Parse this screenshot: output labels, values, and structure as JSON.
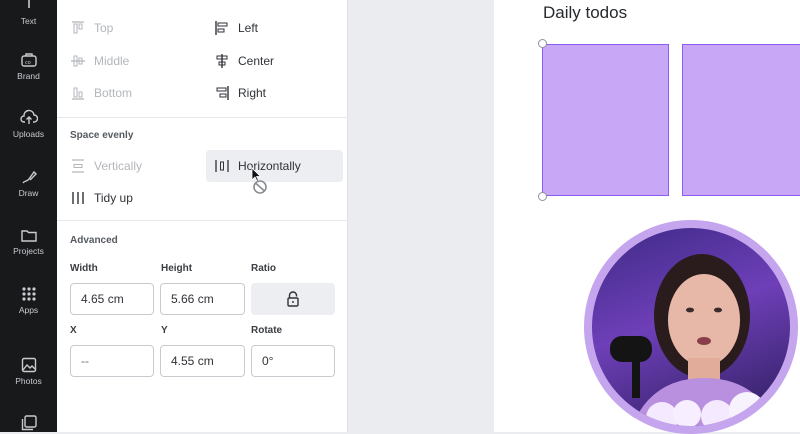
{
  "rail": {
    "items": [
      {
        "label": "Text",
        "icon": "text-icon"
      },
      {
        "label": "Brand",
        "icon": "brand-icon"
      },
      {
        "label": "Uploads",
        "icon": "uploads-icon"
      },
      {
        "label": "Draw",
        "icon": "draw-icon"
      },
      {
        "label": "Projects",
        "icon": "projects-icon"
      },
      {
        "label": "Apps",
        "icon": "apps-icon"
      },
      {
        "label": "Photos",
        "icon": "photos-icon"
      }
    ]
  },
  "align": {
    "top": "Top",
    "middle": "Middle",
    "bottom": "Bottom",
    "left": "Left",
    "center": "Center",
    "right": "Right"
  },
  "space": {
    "title": "Space evenly",
    "vertically": "Vertically",
    "horizontally": "Horizontally",
    "tidy": "Tidy up"
  },
  "advanced": {
    "title": "Advanced",
    "width_label": "Width",
    "height_label": "Height",
    "ratio_label": "Ratio",
    "x_label": "X",
    "y_label": "Y",
    "rotate_label": "Rotate",
    "width": "4.65 cm",
    "height": "5.66 cm",
    "x": "--",
    "y": "4.55 cm",
    "rotate": "0°"
  },
  "canvas": {
    "title": "Daily todos",
    "box_color": "#c8a8f6",
    "border_color": "#8b5cf6"
  }
}
